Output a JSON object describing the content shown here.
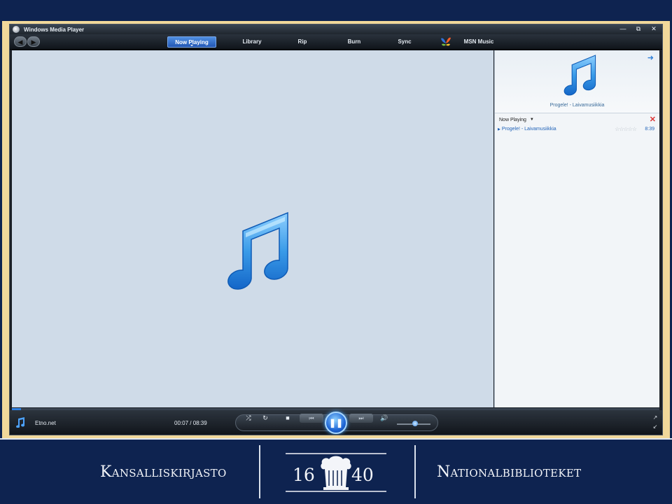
{
  "window": {
    "title": "Windows Media Player",
    "controls": [
      "—",
      "⧉",
      "✕"
    ]
  },
  "nav": {
    "back_icon": "back-arrow-icon",
    "forward_icon": "forward-arrow-icon",
    "tabs": [
      {
        "label": "Now Playing",
        "active": true
      },
      {
        "label": "Library"
      },
      {
        "label": "Rip"
      },
      {
        "label": "Burn"
      },
      {
        "label": "Sync"
      }
    ],
    "online_store": "MSN Music"
  },
  "now_playing": {
    "album_caption": "Progele! - Laivamusiikkia",
    "list_title": "Now Playing",
    "tracks": [
      {
        "title": "Progele! - Laivamusiikkia",
        "rating": "☆☆☆☆☆",
        "duration": "8:39"
      }
    ]
  },
  "player": {
    "progress": 0.014,
    "source": "Etno.net",
    "time": "00:07 / 08:39",
    "volume": 0.55,
    "play_state": "playing",
    "accent": "#2f7fe0"
  },
  "footer": {
    "left": "Kansalliskirjasto",
    "year_left": "16",
    "year_right": "40",
    "right": "Nationalbiblioteket"
  }
}
